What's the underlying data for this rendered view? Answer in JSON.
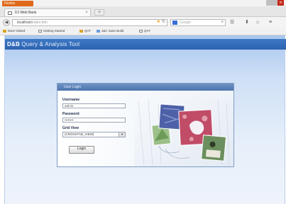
{
  "window": {
    "app_menu_label": "Firefox",
    "close_glyph": "✕"
  },
  "tab": {
    "title": "DJ Web Bank",
    "close_glyph": "×",
    "new_tab_glyph": "+"
  },
  "navbar": {
    "url": "localhost",
    "url_suffix": "/index.htm",
    "search_placeholder": "Google",
    "icons": [
      "back-icon",
      "bookmark-star-icon",
      "reload-icon",
      "search-icon",
      "bookmarks-menu-icon",
      "download-icon",
      "home-icon",
      "menu-icon"
    ]
  },
  "bookmarks": [
    {
      "label": "Most Visited",
      "icon": "folder-icon"
    },
    {
      "label": "Getting Started",
      "icon": "page-icon"
    },
    {
      "label": "QAT",
      "icon": "folder-icon"
    },
    {
      "label": "J&C Suite Build",
      "icon": "page-icon"
    },
    {
      "label": "QAT",
      "icon": "page-icon"
    }
  ],
  "app": {
    "title_bold": "D&B",
    "title_rest": "Query & Analysis Tool"
  },
  "login": {
    "title": "User Login",
    "username_label": "Username",
    "username_value": "admin",
    "password_label": "Password",
    "password_value": "••••••••",
    "gridview_label": "Grid View",
    "gridview_value": "(CROSSTAB_VIEW)",
    "login_button": "Login",
    "dropdown_glyph": "▼"
  },
  "colors": {
    "header_blue": "#2d63b0",
    "panel_header": "#4c74ad",
    "page_gradient_top": "#a8c6ee"
  }
}
